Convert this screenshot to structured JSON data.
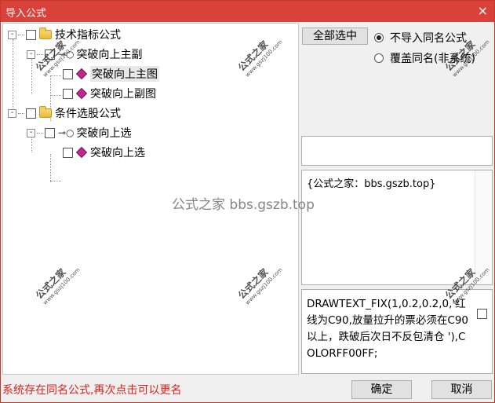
{
  "window": {
    "title": "导入公式",
    "close_symbol": "×"
  },
  "tree": {
    "expander_symbol": "-",
    "nodes": [
      {
        "label": "技术指标公式",
        "type": "folder"
      },
      {
        "label": "突破向上主副",
        "type": "key"
      },
      {
        "label": "突破向上主图",
        "type": "formula"
      },
      {
        "label": "突破向上副图",
        "type": "formula"
      },
      {
        "label": "条件选股公式",
        "type": "folder"
      },
      {
        "label": "突破向上选",
        "type": "key"
      },
      {
        "label": "突破向上选",
        "type": "formula"
      }
    ]
  },
  "right": {
    "select_all_label": "全部选中",
    "radio_options": [
      {
        "label": "不导入同名公式",
        "checked": true
      },
      {
        "label": "覆盖同名(非系统)",
        "checked": false
      }
    ],
    "info_text": "{公式之家：bbs.gszb.top}",
    "formula_text": "DRAWTEXT_FIX(1,0.2,0.2,0,'红线为C90,放量拉升的票必须在C90以上，跌破后次日不反包清仓 '),COLORFF00FF;"
  },
  "footer": {
    "status_message": "系统存在同名公式,再次点击可以更名",
    "ok_label": "确定",
    "cancel_label": "取消"
  },
  "watermarks": {
    "stamp_text": "公式之家",
    "stamp_url": "www.gszj100.com",
    "center_text": "公式之家 bbs.gszb.top"
  },
  "colors": {
    "titlebar": "#d9423a",
    "status_text": "#e0201a",
    "gem_icon": "#c1288c"
  }
}
